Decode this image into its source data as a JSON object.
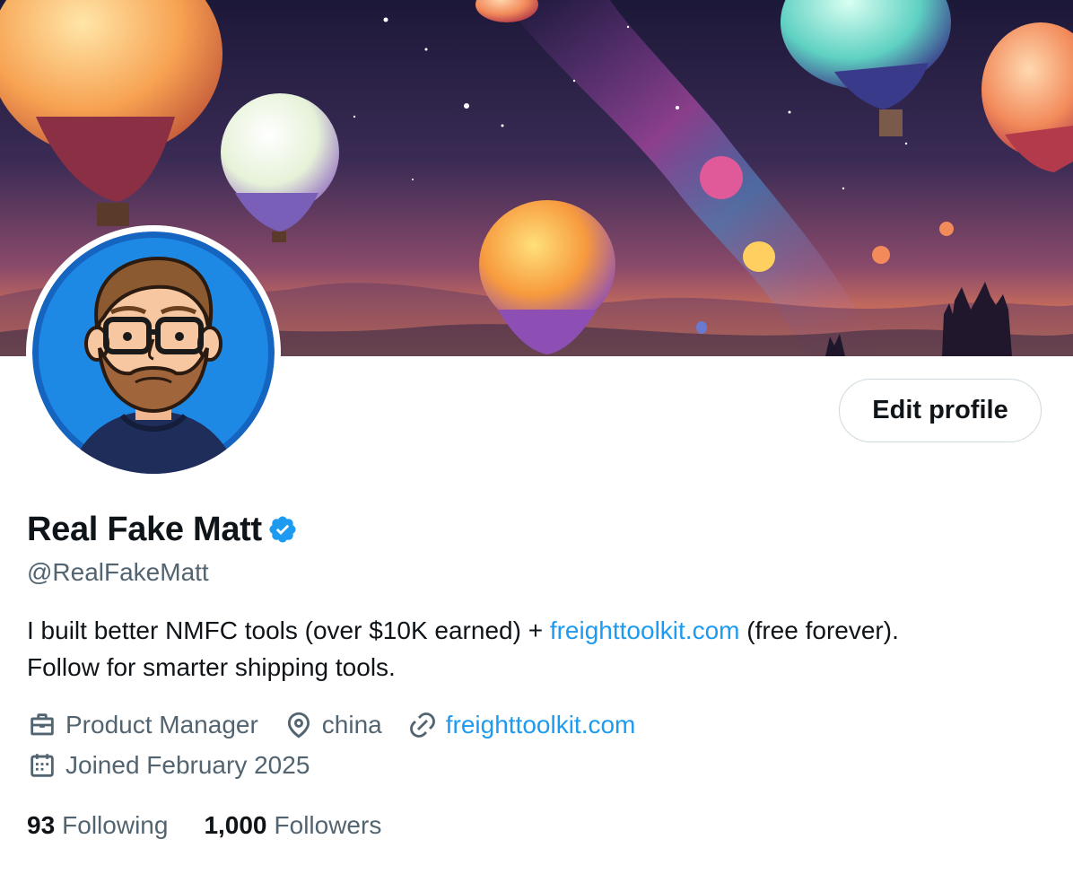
{
  "profile": {
    "display_name": "Real Fake Matt",
    "handle": "@RealFakeMatt",
    "verified_icon": "verified-badge-icon",
    "bio_prefix": "I built better NMFC tools (over $10K earned) + ",
    "bio_link": "freighttoolkit.com",
    "bio_suffix_line1": " (free forever).",
    "bio_line2": "Follow for smarter shipping tools.",
    "job": "Product Manager",
    "location": "china",
    "website": "freighttoolkit.com",
    "joined": "Joined February 2025",
    "following_count": "93",
    "following_label": "Following",
    "followers_count": "1,000",
    "followers_label": "Followers"
  },
  "buttons": {
    "edit_profile": "Edit profile"
  },
  "colors": {
    "link": "#1d9bf0",
    "secondary_text": "#536471",
    "primary_text": "#0f1419",
    "button_border": "#cfd9de",
    "verified": "#1d9bf0"
  },
  "icons": {
    "job": "briefcase-icon",
    "location": "location-pin-icon",
    "website": "link-icon",
    "joined": "calendar-icon"
  }
}
